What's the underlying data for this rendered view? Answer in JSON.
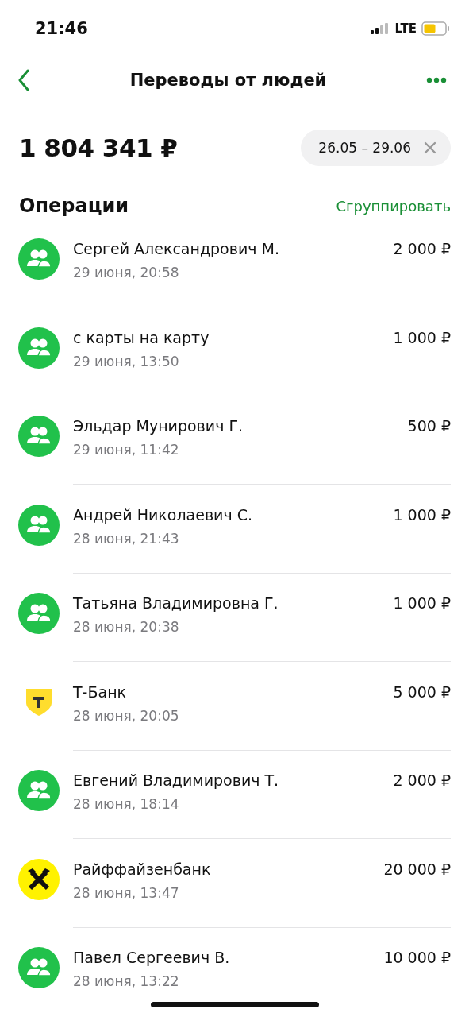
{
  "status_bar": {
    "time": "21:46",
    "network": "LTE"
  },
  "header": {
    "title": "Переводы от людей"
  },
  "summary": {
    "total": "1 804 341 ₽",
    "period": "26.05 – 29.06"
  },
  "operations": {
    "title": "Операции",
    "group_action": "Сгруппировать",
    "items": [
      {
        "kind": "person",
        "name": "Сергей Александрович М.",
        "date": "29 июня, 20:58",
        "amount": "2 000 ₽"
      },
      {
        "kind": "person",
        "name": "с карты на карту",
        "date": "29 июня, 13:50",
        "amount": "1 000 ₽"
      },
      {
        "kind": "person",
        "name": "Эльдар Мунирович Г.",
        "date": "29 июня, 11:42",
        "amount": "500 ₽"
      },
      {
        "kind": "person",
        "name": "Андрей Николаевич С.",
        "date": "28 июня, 21:43",
        "amount": "1 000 ₽"
      },
      {
        "kind": "person",
        "name": "Татьяна Владимировна Г.",
        "date": "28 июня, 20:38",
        "amount": "1 000 ₽"
      },
      {
        "kind": "shield",
        "name": "Т-Банк",
        "date": "28 июня, 20:05",
        "amount": "5 000 ₽"
      },
      {
        "kind": "person",
        "name": "Евгений Владимирович Т.",
        "date": "28 июня, 18:14",
        "amount": "2 000 ₽"
      },
      {
        "kind": "cross",
        "name": "Райффайзенбанк",
        "date": "28 июня, 13:47",
        "amount": "20 000 ₽"
      },
      {
        "kind": "person",
        "name": "Павел Сергеевич В.",
        "date": "28 июня, 13:22",
        "amount": "10 000 ₽"
      }
    ]
  }
}
